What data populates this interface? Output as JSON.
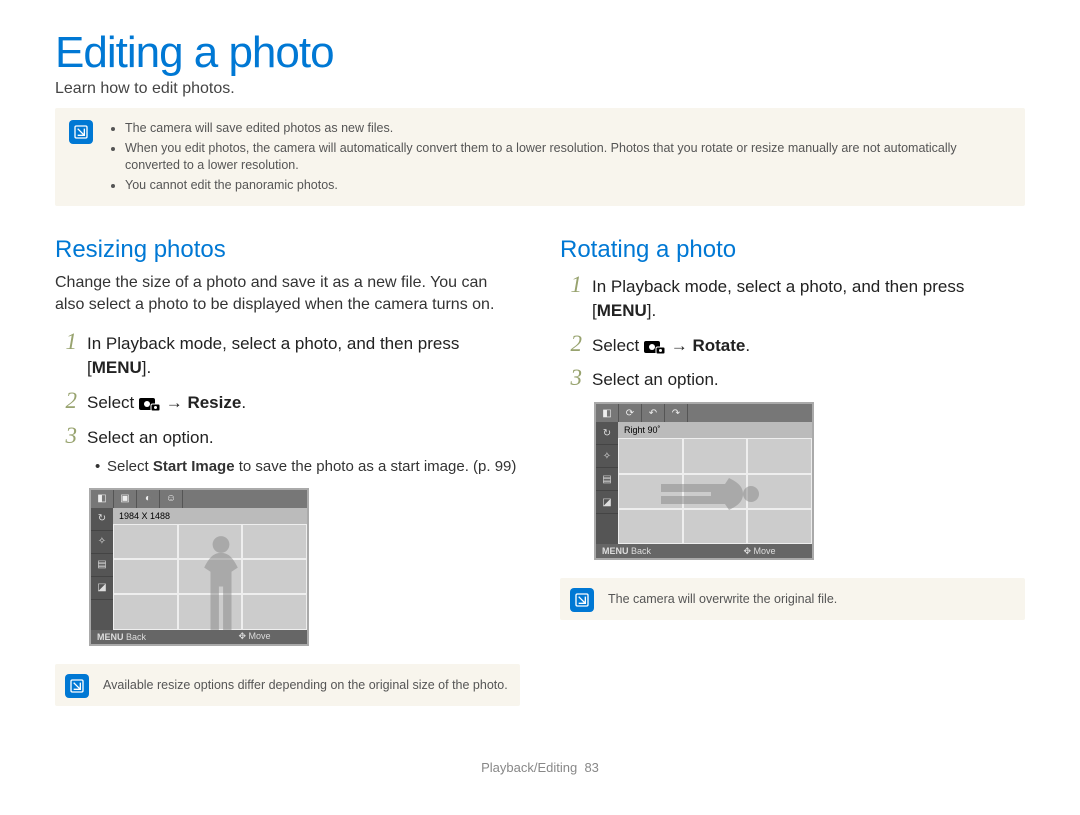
{
  "title": "Editing a photo",
  "subtitle": "Learn how to edit photos.",
  "top_notes": [
    "The camera will save edited photos as new files.",
    "When you edit photos, the camera will automatically convert them to a lower resolution. Photos that you rotate or resize manually are not automatically converted to a lower resolution.",
    "You cannot edit the panoramic photos."
  ],
  "resize": {
    "heading": "Resizing photos",
    "desc": "Change the size of a photo and save it as a new file. You can also select a photo to be displayed when the camera turns on.",
    "steps": {
      "s1_pre": "In Playback mode, select a photo, and then press [",
      "s1_btn": "MENU",
      "s1_post": "].",
      "s2_pre": "Select ",
      "s2_dest": " → Resize",
      "s3": "Select an option.",
      "sub_pre": "Select ",
      "sub_strong": "Start Image",
      "sub_post": " to save the photo as a start image. (p. 99)"
    },
    "screen": {
      "status": "1984 X 1488",
      "back_label": "Back",
      "move_label": "Move",
      "menu_label": "MENU"
    },
    "bottom_note": "Available resize options differ depending on the original size of the photo."
  },
  "rotate": {
    "heading": "Rotating a photo",
    "steps": {
      "s1_pre": "In Playback mode, select a photo, and then press [",
      "s1_btn": "MENU",
      "s1_post": "].",
      "s2_pre": "Select ",
      "s2_dest": " → Rotate",
      "s3": "Select an option."
    },
    "screen": {
      "status": "Right 90˚",
      "back_label": "Back",
      "move_label": "Move",
      "menu_label": "MENU"
    },
    "bottom_note": "The camera will overwrite the original file."
  },
  "footer": {
    "section": "Playback/Editing",
    "page": "83"
  }
}
